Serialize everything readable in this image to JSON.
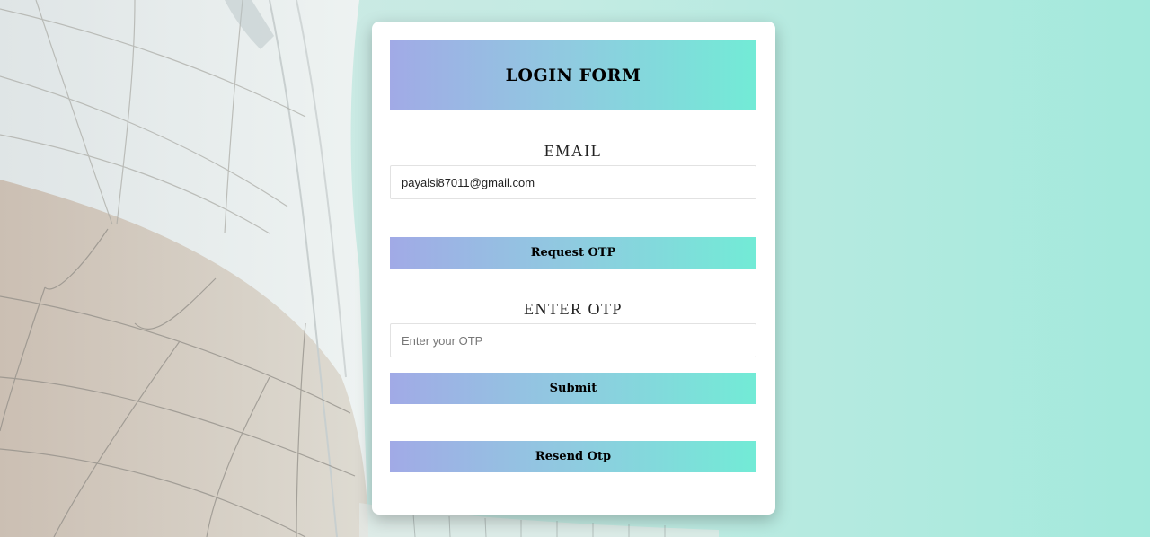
{
  "form": {
    "title": "LOGIN FORM",
    "email_label": "EMAIL",
    "email_value": "payalsi87011@gmail.com",
    "request_otp_label": "Request OTP",
    "otp_label": "ENTER OTP",
    "otp_placeholder": "Enter your OTP",
    "otp_value": "",
    "submit_label": "Submit",
    "resend_label": "Resend Otp"
  },
  "colors": {
    "gradient_start": "#a1aae6",
    "gradient_end": "#72ebd6",
    "background_right": "#a3e9dc",
    "card": "#ffffff"
  }
}
